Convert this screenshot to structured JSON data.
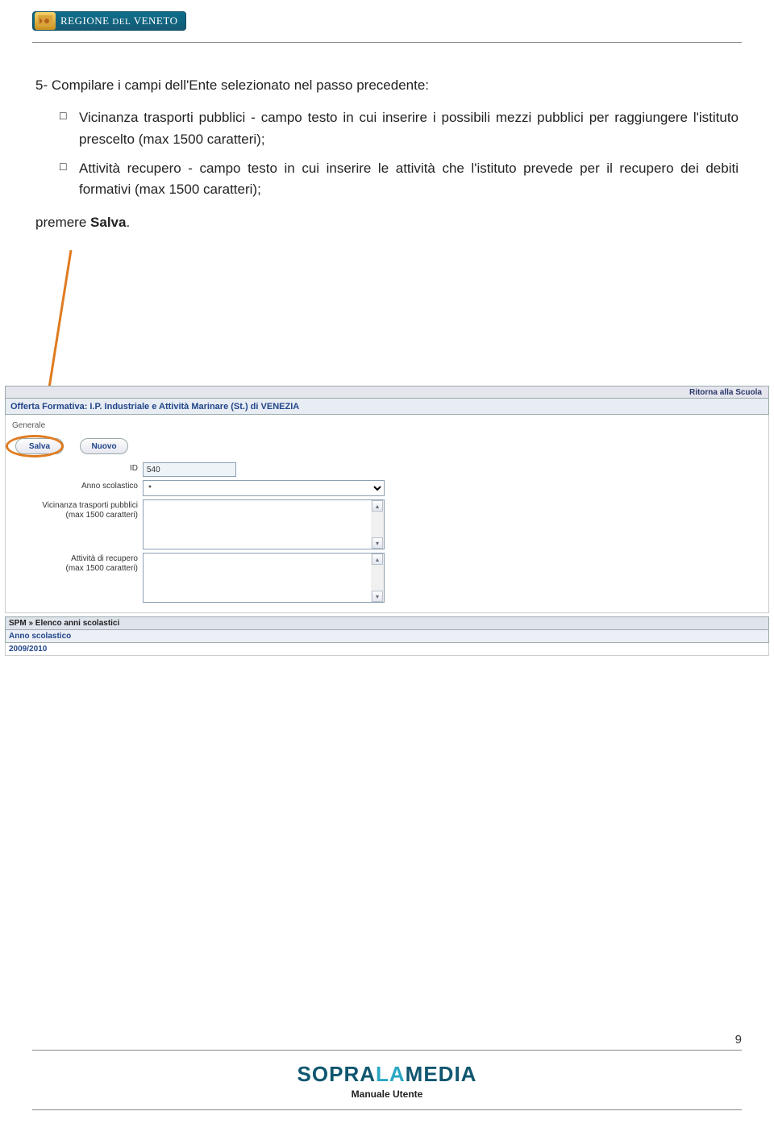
{
  "header": {
    "region_prefix": "REGIONE ",
    "region_small": "DEL",
    "region_suffix": " VENETO"
  },
  "instructions": {
    "lead": "5- Compilare i campi dell'Ente selezionato nel passo precedente:",
    "bullet1": "Vicinanza trasporti pubblici - campo testo in cui inserire i possibili mezzi pubblici per raggiungere l'istituto prescelto (max 1500 caratteri);",
    "bullet2": "Attività recupero - campo testo in cui inserire le attività che l'istituto prevede per il recupero dei debiti formativi (max 1500 caratteri);",
    "premere_pre": "premere ",
    "premere_bold": "Salva",
    "premere_post": "."
  },
  "app": {
    "back_link": "Ritorna alla Scuola",
    "title": "Offerta Formativa: I.P. Industriale e Attività Marinare (St.) di VENEZIA",
    "generale": "Generale",
    "buttons": {
      "salva": "Salva",
      "nuovo": "Nuovo"
    },
    "fields": {
      "id_label": "ID",
      "id_value": "540",
      "anno_label": "Anno scolastico",
      "anno_value": "*",
      "vicinanza_label_l1": "Vicinanza trasporti pubblici",
      "vicinanza_label_l2": "(max 1500 caratteri)",
      "attivita_label_l1": "Attività di recupero",
      "attivita_label_l2": "(max 1500 caratteri)"
    },
    "spm": {
      "breadcrumb": "SPM » Elenco anni scolastici",
      "col": "Anno scolastico",
      "row": "2009/2010"
    }
  },
  "footer": {
    "page": "9",
    "logo_a": "SOPR",
    "logo_b": "A",
    "logo_la": "LA",
    "logo_c": "MEDIA",
    "sub": "Manuale Utente"
  }
}
